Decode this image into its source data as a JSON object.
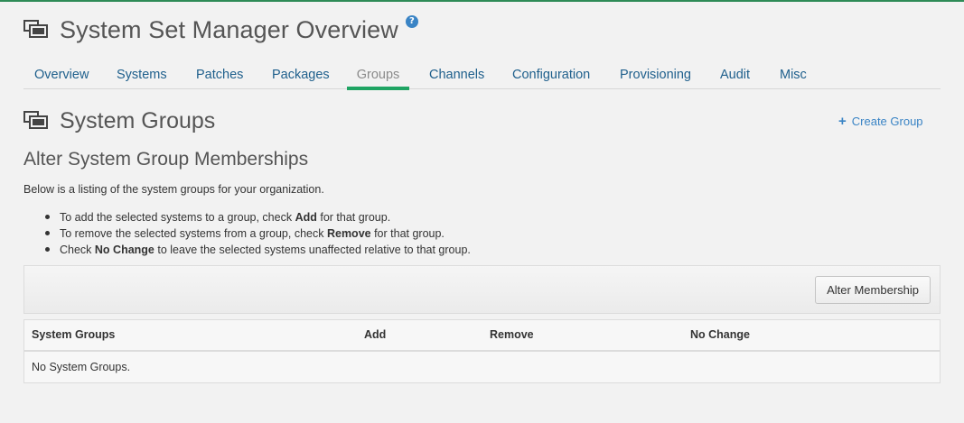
{
  "header": {
    "title": "System Set Manager Overview",
    "help_icon": "?"
  },
  "tabs": [
    {
      "label": "Overview",
      "active": false
    },
    {
      "label": "Systems",
      "active": false
    },
    {
      "label": "Patches",
      "active": false
    },
    {
      "label": "Packages",
      "active": false
    },
    {
      "label": "Groups",
      "active": true
    },
    {
      "label": "Channels",
      "active": false
    },
    {
      "label": "Configuration",
      "active": false
    },
    {
      "label": "Provisioning",
      "active": false
    },
    {
      "label": "Audit",
      "active": false
    },
    {
      "label": "Misc",
      "active": false
    }
  ],
  "section": {
    "title": "System Groups",
    "create_label": "Create Group",
    "create_icon": "+"
  },
  "content": {
    "subtitle": "Alter System Group Memberships",
    "description": "Below is a listing of the system groups for your organization.",
    "bullets": [
      {
        "pre": "To add the selected systems to a group, check ",
        "bold": "Add",
        "post": " for that group."
      },
      {
        "pre": "To remove the selected systems from a group, check ",
        "bold": "Remove",
        "post": " for that group."
      },
      {
        "pre": "Check ",
        "bold": "No Change",
        "post": " to leave the selected systems unaffected relative to that group."
      }
    ]
  },
  "actions": {
    "alter_label": "Alter Membership"
  },
  "table": {
    "columns": [
      "System Groups",
      "Add",
      "Remove",
      "No Change"
    ],
    "empty_message": "No System Groups."
  },
  "colors": {
    "accent": "#1fa463",
    "link": "#1e5f8c",
    "help": "#3a84c5"
  }
}
